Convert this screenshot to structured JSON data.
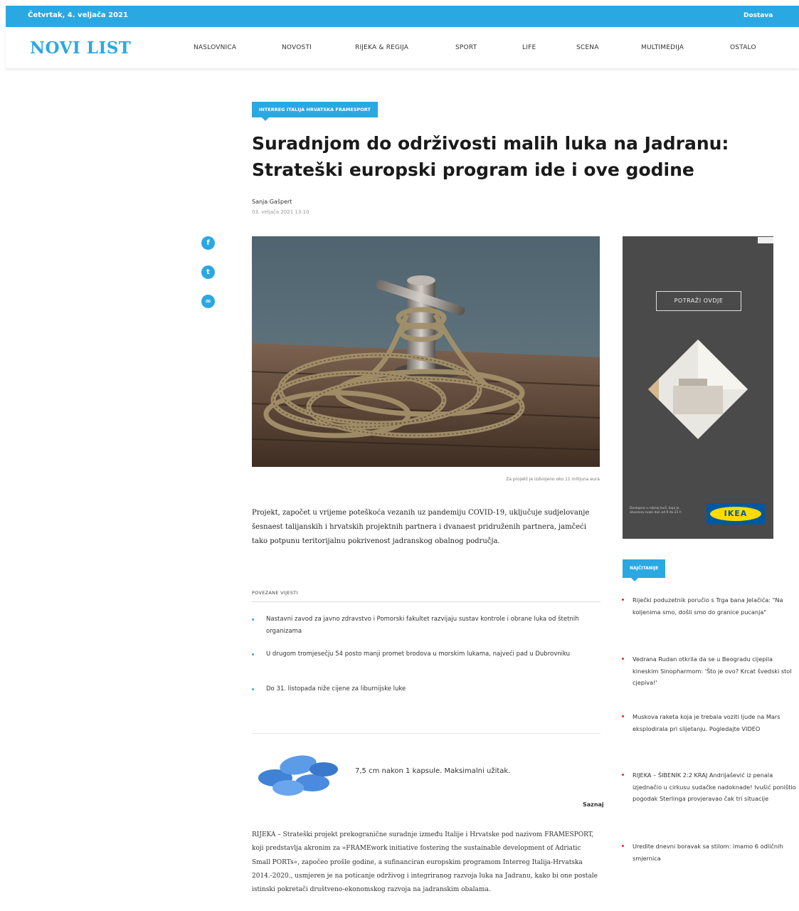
{
  "topbar": {
    "date": "Četvrtak, 4. veljača 2021",
    "right": "Dostava"
  },
  "header": {
    "logo": "NOVI LIST",
    "nav": [
      "NASLOVNICA",
      "NOVOSTI",
      "RIJEKA & REGIJA",
      "SPORT",
      "LIFE",
      "SCENA",
      "MULTIMEDIJA",
      "OSTALO"
    ]
  },
  "article": {
    "kicker": "INTERREG ITALIJA HRVATSKA FRAMESPORT",
    "title": "Suradnjom do održivosti malih luka na Jadranu: Strateški europski program ide i ove godine",
    "author": "Sanja Gašpert",
    "date": "03. veljača 2021 13:10",
    "caption": "Za projekt je izdvojeno oko 11 milijuna eura",
    "lead": "Projekt, započet u vrijeme poteškoća vezanih uz pandemiju COVID-19, uključuje sudjelovanje šesnaest talijanskih i hrvatskih projektnih partnera i dvanaest pridruženih partnera, jamčeći tako potpunu teritorijalnu pokrivenost jadranskog obalnog područja.",
    "body": "RIJEKA – Strateški projekt prekogranične suradnje između Italije i Hrvatske pod nazivom FRAMESPORT, koji predstavlja akronim za »FRAMEwork initiative fostering the sustainable development of Adriatic Small PORTs«, započeo prošle godine, a sufinanciran europskim programom Interreg Italija-Hrvatska 2014.-2020., usmjeren je na poticanje održivog i integriranog razvoja luka na Jadranu, kako bi one postale istinski pokretači društveno-ekonomskog razvoja na jadranskim obalama."
  },
  "share": {
    "icons": [
      "facebook-icon",
      "twitter-icon",
      "link-icon"
    ],
    "glyphs": [
      "f",
      "t",
      "∞"
    ]
  },
  "related": {
    "title": "POVEZANE VIJESTI",
    "items": [
      "Nastavni zavod za javno zdravstvo i Pomorski fakultet razvijaju sustav kontrole i obrane luka od štetnih organizama",
      "U drugom tromjesečju 54 posto manji promet brodova u morskim lukama, najveći pad u Dubrovniku",
      "Do 31. listopada niže cijene za liburnijske luke"
    ]
  },
  "promo": {
    "text": "7,5 cm nakon 1 kapsule. Maksimalni užitak.",
    "link": "Saznaj"
  },
  "ad": {
    "button": "POTRAŽI OVDJE",
    "small": "Dostupno u robnoj kući, koja je otvorena svaki dan od 9 do 21 h",
    "logo": "IKEA",
    "colors": {
      "logo_blue": "#0058a3",
      "logo_yellow": "#ffdb00"
    }
  },
  "most_read": {
    "title": "NAJČITANIJE",
    "items": [
      "Riječki poduzetnik poručio s Trga bana Jelačića: \"Na koljenima smo, došli smo do granice pucanja\"",
      "Vedrana Rudan otkrila da se u Beogradu cijepila kineskim Sinopharmom: 'Što je ovo? Krcat švedski stol cjepiva!'",
      "Muskova raketa koja je trebala voziti ljude na Mars eksplodirala pri slijetanju. Pogledajte VIDEO",
      "RIJEKA – ŠIBENIK 2:2 KRAJ Andrijašević iz penala izjednačio u cirkusu sudačke nadoknade! Ivušić poništio pogodak Sterlinga provjeravao čak tri situacije",
      "Uredite dnevni boravak sa stilom: imamo 6 odličnih smjernica"
    ]
  },
  "colors": {
    "accent": "#2aa8e2",
    "dot_red": "#e02b2b"
  }
}
